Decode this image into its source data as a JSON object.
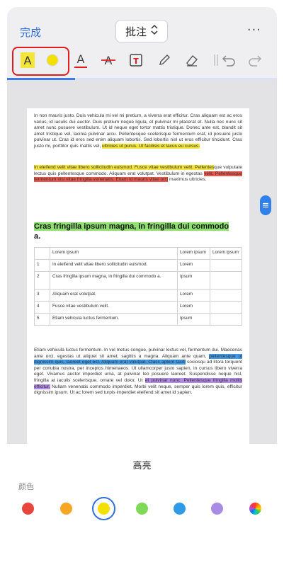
{
  "header": {
    "done_label": "完成",
    "mode_label": "批注",
    "more_label": "···"
  },
  "toolbar": {
    "selected_tool": "highlight",
    "tools": [
      "highlight-text",
      "highlight-color",
      "underline",
      "strikethrough",
      "text-box",
      "pencil",
      "eraser",
      "undo",
      "redo"
    ]
  },
  "document": {
    "para1": "In non mauris justo. Duis vehicula mi vel mi pretium, a viverra erat efficitur. Cras aliquam est ac eros varius, id iaculis dui auctor. Duis pretium neque ligula, et pulvinar mi placerat et. Nulla nec nunc sit amet nunc posuere vestibulum. Ut id neque eget tortor mattis tristique. Donec ante est, blandit sit amet tristique vel, lacinia pulvinar arcu. Pellentesque scelerisque fermentum erat, id posuere justo pulvinar ut. Cras id eros sed enim aliquam lobortis. Sed lobortis nisl ut eros efficitur tincidunt. Cras justo mi, porttitor quis mattis vel,",
    "para1_hl": "ultricies ut purus. Ut facilisis et lacus eu cursus.",
    "para2_hl_yellow": "In eleifend velit vitae libero sollicitudin euismod. Fusce vitae vestibulum velit. Pellentes",
    "para2_plain": "que vulputate lectus quis pellentesque commodo. Aliquam erat volutpat. Vestibulum in egestas",
    "para2_hl_red": "velit. Pellentesque fermentum nisi vitae fringilla venenatis. Etiam id mauris vitae orci",
    "para2_tail": "maximus ultricies.",
    "heading_hl": "Cras fringilla ipsum magna, in fringilla dui commodo",
    "heading_tail": "a.",
    "table": {
      "header": [
        "",
        "Lorem ipsum",
        "Lorem ipsum",
        "Lorem ipsum"
      ],
      "rows": [
        [
          "1",
          "In eleifend velit vitae libero sollicitudin euismod.",
          "Lorem",
          ""
        ],
        [
          "2",
          "Cras fringilla ipsum magna, in fringilla dui commodo a.",
          "Ipsum",
          ""
        ],
        [
          "3",
          "Aliquam erat volutpat.",
          "Lorem",
          ""
        ],
        [
          "4",
          "Fusce vitae vestibulum velit.",
          "Lorem",
          ""
        ],
        [
          "5",
          "Etiam vehicula luctus fermentum.",
          "Ipsum",
          ""
        ]
      ]
    },
    "para3_a": "Etiam vehicula luctus fermentum. In vel metus congue, pulvinar lectus vel, fermentum dui. Maecenas ante orci, egestas ut aliquet sit amet, sagittis a magna. Aliquam ante quam,",
    "para3_hl_blue": "pellentesque ut dignissim quis, laoreet eget est. Aliquam erat volutpat. Class aptent taciti",
    "para3_b": "sociosqu ad litora torquent per conubia nostra, per inceptos himenaeos. Ut ullamcorper justo sapien, in cursus libero viverra eget. Vivamus auctor imperdiet urna, at pulvinar leo posuere laoreet. Suspendisse neque nisl, fringilla at iaculis scelerisque, ornare vel dolor. Ut",
    "para3_hl_purple": "et pulvinar nunc. Pellentesque fringilla mollis efficitur.",
    "para3_c": "Nullam venenatis commodo imperdiet. Morbi velit neque, semper quis lorem quis, efficitur dignissim ipsum. Ut ac lorem sed turpis imperdiet eleifend sit amet id sapien."
  },
  "sheet": {
    "title": "高亮",
    "color_label": "颜色",
    "colors": [
      "#e8453c",
      "#f5a623",
      "#f4e000",
      "#7ed957",
      "#2e9ae8",
      "#a98be6"
    ],
    "selected_color": "#f4e000"
  }
}
